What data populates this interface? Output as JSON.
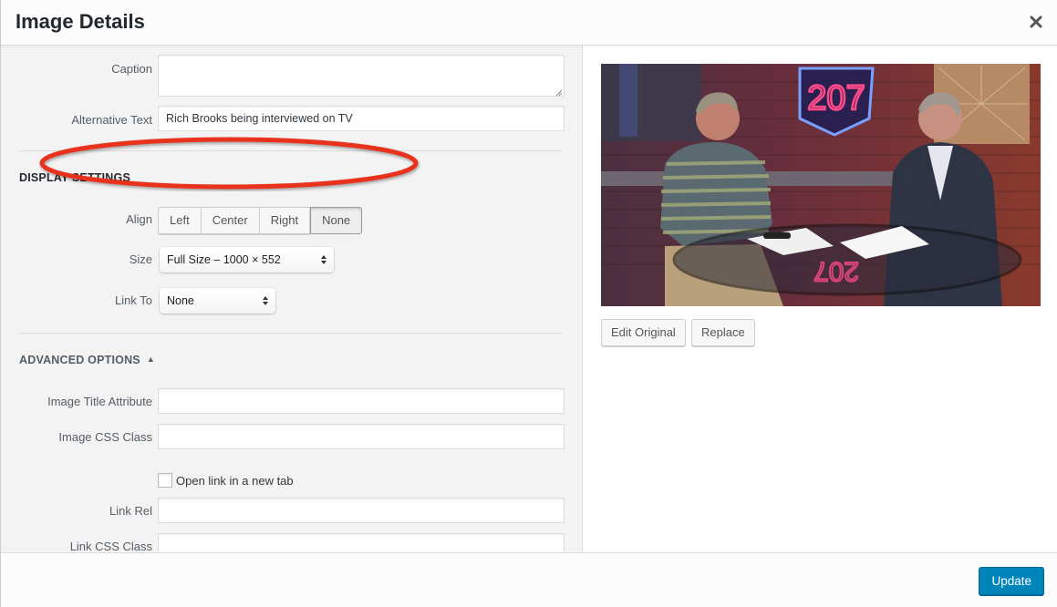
{
  "dialog": {
    "title": "Image Details",
    "close_icon": "close-x-icon"
  },
  "form": {
    "caption": {
      "label": "Caption",
      "value": ""
    },
    "alt_text": {
      "label": "Alternative Text",
      "value": "Rich Brooks being interviewed on TV"
    },
    "display_settings": {
      "title": "DISPLAY SETTINGS",
      "align": {
        "label": "Align",
        "options": [
          "Left",
          "Center",
          "Right",
          "None"
        ],
        "selected": "None"
      },
      "size": {
        "label": "Size",
        "value": "Full Size – 1000 × 552"
      },
      "link_to": {
        "label": "Link To",
        "value": "None"
      }
    },
    "advanced": {
      "title": "ADVANCED OPTIONS",
      "toggle_icon": "triangle-up-icon",
      "image_title_attribute": {
        "label": "Image Title Attribute",
        "value": ""
      },
      "image_css_class": {
        "label": "Image CSS Class",
        "value": ""
      },
      "open_new_tab": {
        "label": "Open link in a new tab",
        "checked": false
      },
      "link_rel": {
        "label": "Link Rel",
        "value": ""
      },
      "link_css_class": {
        "label": "Link CSS Class",
        "value": ""
      }
    }
  },
  "annotation": {
    "color": "#e8321f"
  },
  "preview": {
    "description": "Two men seated at a glass table on a TV set with neon '207' sign and brick wall",
    "edit_original_label": "Edit Original",
    "replace_label": "Replace"
  },
  "footer": {
    "update_label": "Update",
    "accent": "#0085ba"
  }
}
